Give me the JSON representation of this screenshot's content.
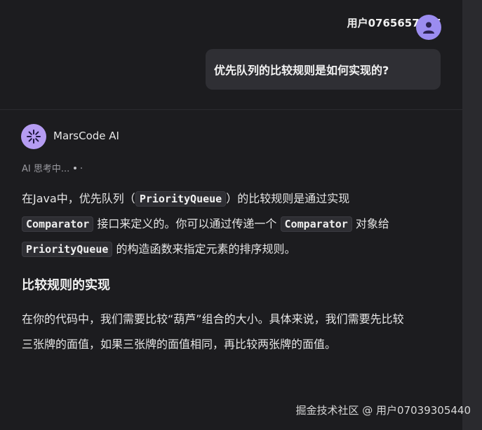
{
  "user": {
    "name": "用户0765657875",
    "question": "优先队列的比较规则是如何实现的?"
  },
  "ai": {
    "name": "MarsCode AI",
    "status": "AI 思考中..."
  },
  "answer": {
    "p1_a": "在Java中，优先队列（",
    "p1_code1": "PriorityQueue",
    "p1_b": "）的比较规则是通过实现",
    "p1_code2": "Comparator",
    "p1_c": "接口来定义的。你可以通过传递一个",
    "p1_code3": "Comparator",
    "p1_d": "对象给",
    "p1_code4": "PriorityQueue",
    "p1_e": "的构造函数来指定元素的排序规则。",
    "heading": "比较规则的实现",
    "p2": "在你的代码中，我们需要比较“葫芦”组合的大小。具体来说，我们需要先比较三张牌的面值，如果三张牌的面值相同，再比较两张牌的面值。"
  },
  "watermark": "掘金技术社区 @ 用户07039305440",
  "colors": {
    "background": "#1c1c1f",
    "bubble": "#2f2f34",
    "user_avatar": "#9b8cf0",
    "ai_avatar": "#b59cf2"
  },
  "icons": {
    "user_avatar": "person-icon",
    "ai_avatar": "sparkle-icon"
  }
}
